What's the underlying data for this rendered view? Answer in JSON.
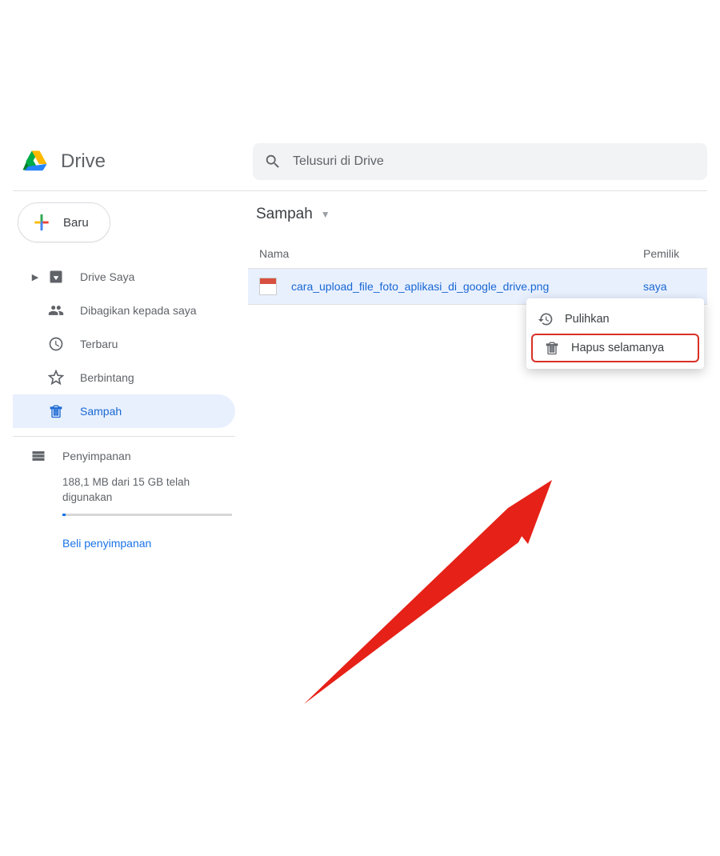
{
  "app": {
    "name": "Drive"
  },
  "search": {
    "placeholder": "Telusuri di Drive"
  },
  "newButton": {
    "label": "Baru"
  },
  "sidebar": {
    "items": [
      {
        "label": "Drive Saya"
      },
      {
        "label": "Dibagikan kepada saya"
      },
      {
        "label": "Terbaru"
      },
      {
        "label": "Berbintang"
      },
      {
        "label": "Sampah"
      }
    ],
    "storage": {
      "label": "Penyimpanan",
      "usage": "188,1 MB dari 15 GB telah digunakan",
      "buy": "Beli penyimpanan"
    }
  },
  "main": {
    "title": "Sampah",
    "columns": {
      "name": "Nama",
      "owner": "Pemilik"
    },
    "file": {
      "name": "cara_upload_file_foto_aplikasi_di_google_drive.png",
      "owner": "saya"
    }
  },
  "contextMenu": {
    "restore": "Pulihkan",
    "deleteForever": "Hapus selamanya"
  }
}
